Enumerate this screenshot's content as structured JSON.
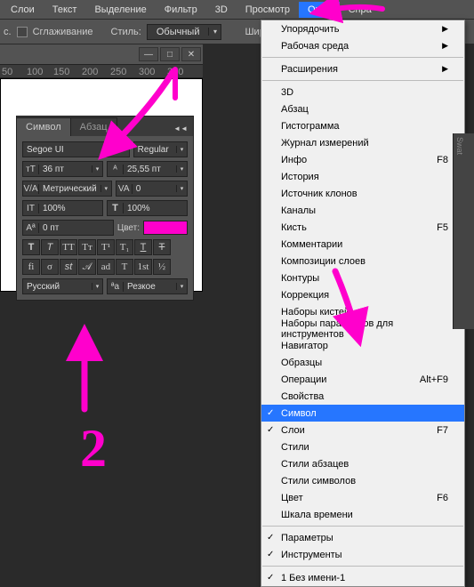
{
  "menubar": {
    "items": [
      "Слои",
      "Текст",
      "Выделение",
      "Фильтр",
      "3D",
      "Просмотр",
      "Окно",
      "Спра"
    ]
  },
  "toolbar": {
    "smoothing": "Сглаживание",
    "style_label": "Стиль:",
    "style_value": "Обычный",
    "width_label": "Шир.:"
  },
  "ruler": [
    "50",
    "100",
    "150",
    "200",
    "250",
    "300",
    "350"
  ],
  "char_panel": {
    "tab1": "Символ",
    "tab2": "Абзац",
    "font": "Segoe UI",
    "weight": "Regular",
    "size": "36 пт",
    "leading": "25,55 пт",
    "kerning": "Метрический",
    "tracking": "0",
    "vscale": "100%",
    "hscale": "100%",
    "baseline": "0 пт",
    "color_label": "Цвет:",
    "lang": "Русский",
    "aa": "Резкое"
  },
  "char_color": "#ff00cc",
  "menu": {
    "items": [
      {
        "label": "Упорядочить",
        "sub": true
      },
      {
        "label": "Рабочая среда",
        "sub": true
      },
      {
        "sep": true
      },
      {
        "label": "Расширения",
        "sub": true
      },
      {
        "sep": true
      },
      {
        "label": "3D"
      },
      {
        "label": "Абзац"
      },
      {
        "label": "Гистограмма"
      },
      {
        "label": "Журнал измерений"
      },
      {
        "label": "Инфо",
        "sc": "F8"
      },
      {
        "label": "История"
      },
      {
        "label": "Источник клонов"
      },
      {
        "label": "Каналы"
      },
      {
        "label": "Кисть",
        "sc": "F5"
      },
      {
        "label": "Комментарии"
      },
      {
        "label": "Композиции слоев"
      },
      {
        "label": "Контуры"
      },
      {
        "label": "Коррекция"
      },
      {
        "label": "Наборы кистей"
      },
      {
        "label": "Наборы параметров для инструментов"
      },
      {
        "label": "Навигатор"
      },
      {
        "label": "Образцы"
      },
      {
        "label": "Операции",
        "sc": "Alt+F9"
      },
      {
        "label": "Свойства"
      },
      {
        "label": "Символ",
        "checked": true,
        "sel": true
      },
      {
        "label": "Слои",
        "checked": true,
        "sc": "F7"
      },
      {
        "label": "Стили"
      },
      {
        "label": "Стили абзацев"
      },
      {
        "label": "Стили символов"
      },
      {
        "label": "Цвет",
        "sc": "F6"
      },
      {
        "label": "Шкала времени"
      },
      {
        "sep": true
      },
      {
        "label": "Параметры",
        "checked": true
      },
      {
        "label": "Инструменты",
        "checked": true
      },
      {
        "sep": true
      },
      {
        "label": "1 Без имени-1",
        "checked": true
      }
    ]
  },
  "side": {
    "tab": "Swat"
  },
  "annot": {
    "num": "2"
  }
}
